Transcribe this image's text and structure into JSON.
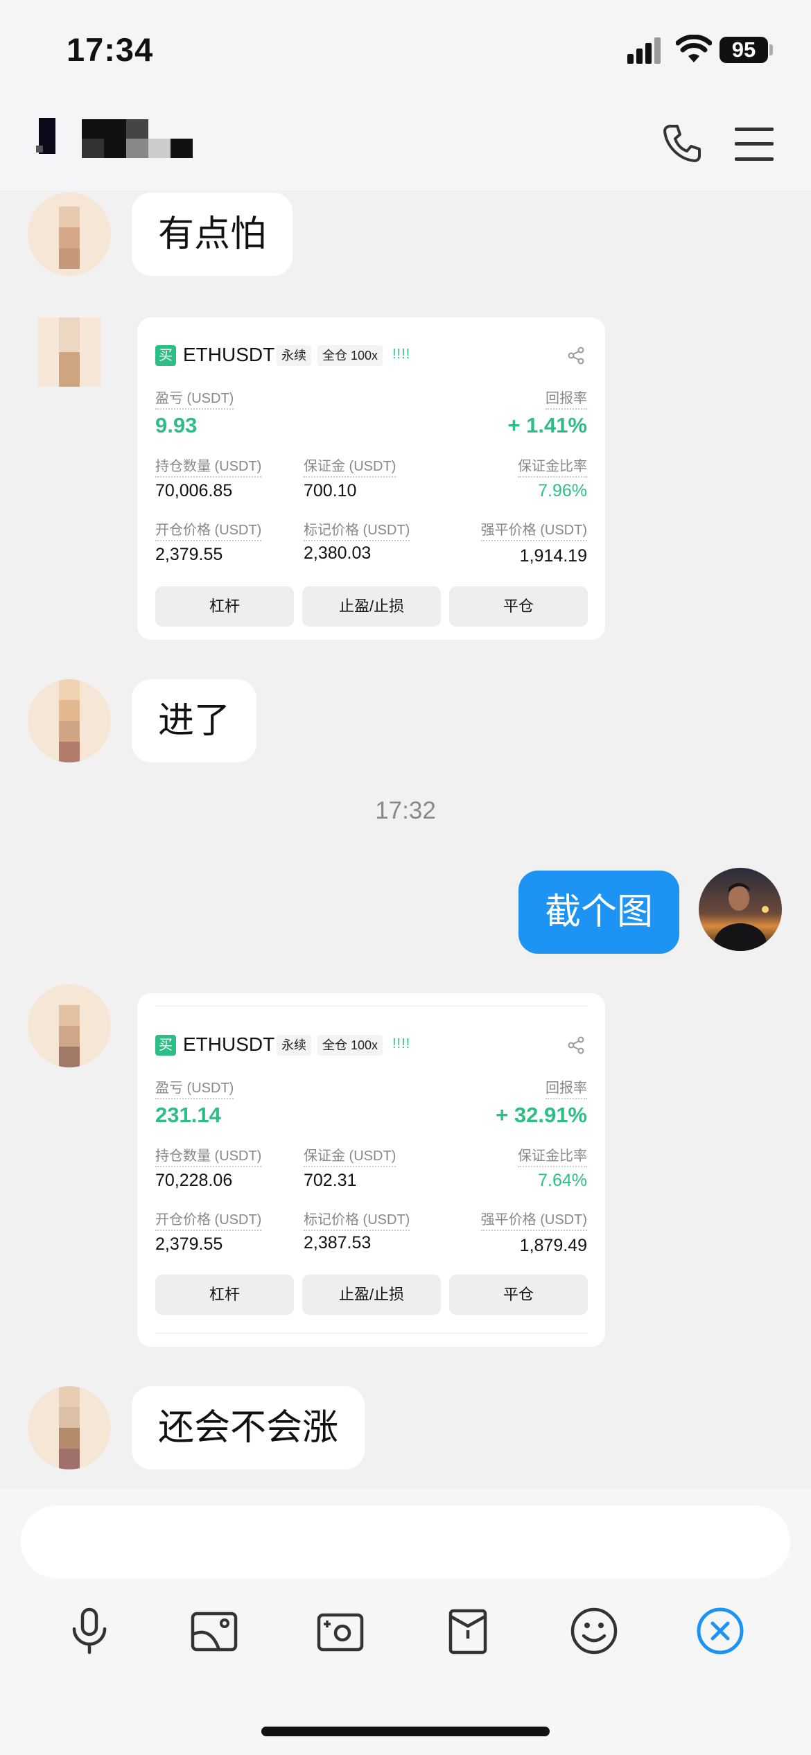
{
  "status_bar": {
    "time": "17:34",
    "battery": "95"
  },
  "messages": [
    {
      "text": "有点怕"
    },
    {
      "text": "进了"
    },
    {
      "text": "截个图"
    },
    {
      "text": "还会不会涨"
    }
  ],
  "timestamp": "17:32",
  "cards": [
    {
      "buy": "买",
      "symbol": "ETHUSDT",
      "type": "永续",
      "margin": "全仓 100x",
      "bars": "!!!!",
      "pnl_label": "盈亏 (USDT)",
      "pnl": "9.93",
      "roe_label": "回报率",
      "roe": "+ 1.41%",
      "size_label": "持仓数量 (USDT)",
      "size": "70,006.85",
      "margin_label": "保证金 (USDT)",
      "margin_val": "700.10",
      "ratio_label": "保证金比率",
      "ratio": "7.96%",
      "entry_label": "开仓价格 (USDT)",
      "entry": "2,379.55",
      "mark_label": "标记价格 (USDT)",
      "mark": "2,380.03",
      "liq_label": "强平价格 (USDT)",
      "liq": "1,914.19",
      "btn_leverage": "杠杆",
      "btn_tpsl": "止盈/止损",
      "btn_close": "平仓"
    },
    {
      "buy": "买",
      "symbol": "ETHUSDT",
      "type": "永续",
      "margin": "全仓 100x",
      "bars": "!!!!",
      "pnl_label": "盈亏 (USDT)",
      "pnl": "231.14",
      "roe_label": "回报率",
      "roe": "+ 32.91%",
      "size_label": "持仓数量 (USDT)",
      "size": "70,228.06",
      "margin_label": "保证金 (USDT)",
      "margin_val": "702.31",
      "ratio_label": "保证金比率",
      "ratio": "7.64%",
      "entry_label": "开仓价格 (USDT)",
      "entry": "2,379.55",
      "mark_label": "标记价格 (USDT)",
      "mark": "2,387.53",
      "liq_label": "强平价格 (USDT)",
      "liq": "1,879.49",
      "btn_leverage": "杠杆",
      "btn_tpsl": "止盈/止损",
      "btn_close": "平仓"
    }
  ],
  "icons": [
    "phone-icon",
    "menu-icon",
    "microphone-icon",
    "image-icon",
    "camera-icon",
    "red-envelope-icon",
    "emoji-icon",
    "close-circle-icon"
  ],
  "colors": {
    "accent": "#1d93f3",
    "profit": "#2ebd85"
  }
}
